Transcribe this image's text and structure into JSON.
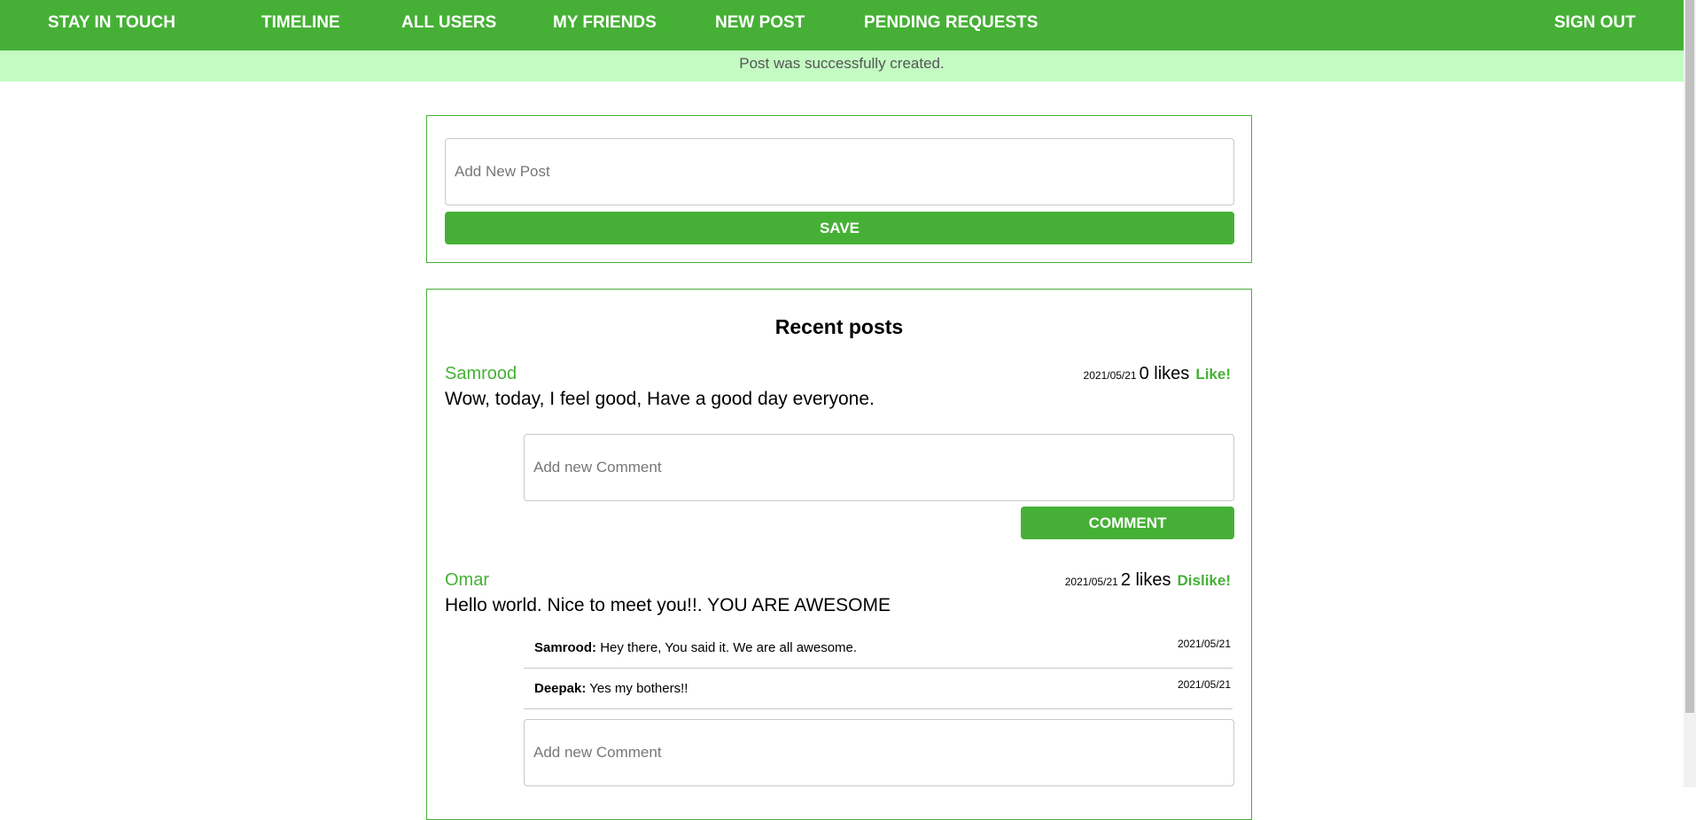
{
  "nav": {
    "brand": "STAY IN TOUCH",
    "links": [
      "TIMELINE",
      "ALL USERS",
      "MY FRIENDS",
      "NEW POST",
      "PENDING REQUESTS"
    ],
    "sign_out": "SIGN OUT"
  },
  "notice": "Post was successfully created.",
  "new_post": {
    "placeholder": "Add New Post",
    "save_label": "SAVE"
  },
  "recent_posts": {
    "title": "Recent posts",
    "comment_placeholder": "Add new Comment",
    "comment_button": "COMMENT",
    "posts": [
      {
        "author": "Samrood",
        "date": "2021/05/21",
        "likes": "0 likes",
        "action": "Like!",
        "body": "Wow, today, I feel good, Have a good day everyone.",
        "comments": []
      },
      {
        "author": "Omar",
        "date": "2021/05/21",
        "likes": "2 likes",
        "action": "Dislike!",
        "body": "Hello world. Nice to meet you!!. YOU ARE AWESOME",
        "comments": [
          {
            "author": "Samrood:",
            "text": "Hey there, You said it. We are all awesome.",
            "date": "2021/05/21"
          },
          {
            "author": "Deepak:",
            "text": "Yes my bothers!!",
            "date": "2021/05/21"
          }
        ]
      }
    ]
  },
  "colors": {
    "brand_green": "#46b036",
    "notice_bg": "#c3fbc3"
  }
}
